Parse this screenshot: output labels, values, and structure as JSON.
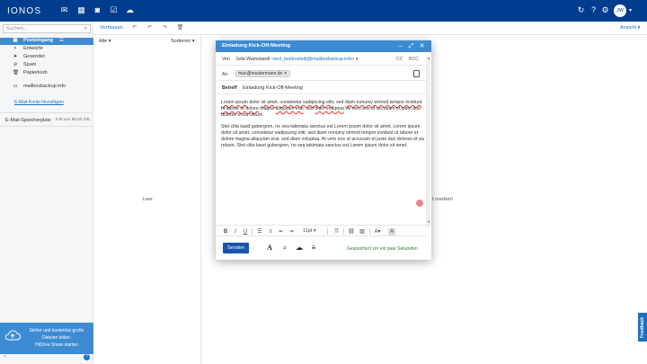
{
  "topbar": {
    "logo": "IONOS",
    "avatar_initials": "JW",
    "nav_icons": [
      "mail-icon",
      "calendar-icon",
      "contacts-icon",
      "tasks-icon",
      "cloud-icon"
    ],
    "right_icons": [
      "refresh-icon",
      "help-icon",
      "settings-icon"
    ]
  },
  "sidebar": {
    "search_placeholder": "Suchen...",
    "folders": [
      {
        "label": "Posteingang",
        "icon": "inbox-icon",
        "active": true
      },
      {
        "label": "Entwürfe",
        "icon": "drafts-icon"
      },
      {
        "label": "Gesendet",
        "icon": "sent-icon"
      },
      {
        "label": "Spam",
        "icon": "spam-icon"
      },
      {
        "label": "Papierkorb",
        "icon": "trash-icon"
      }
    ],
    "account_folder": "mailboxbackup.info",
    "add_account": "E-Mail-Konto hinzufügen",
    "storage_label": "E-Mail-Speicherplatz",
    "storage_value": "0 B von 50,00 GB",
    "hidrive": {
      "line1": "Sicher und kostenlos große",
      "line2": "Dateien teilen:",
      "line3": "HiDrive Share starten"
    }
  },
  "toolbar": {
    "compose": "Verfassen",
    "view": "Ansicht"
  },
  "list": {
    "filter": "Alle",
    "sort": "Sortieren",
    "empty": "Leer",
    "detail_hint": "t markiert"
  },
  "compose": {
    "title": "Einladung Kick-Off-Meeting",
    "from_label": "Von",
    "from_name": "Julia Warnstaedt",
    "from_addr": "<test_testtrustedt@mailboxbackup.info>",
    "cc": "CC",
    "bcc": "BCC",
    "to_label": "An",
    "to_chip": "max@mustermann.de",
    "subject_label": "Betreff",
    "subject": "Einladung Kick-Off-Meeting",
    "p1_a": "Lorem ipsum",
    "p1_b": " dolor ",
    "p1_c": "sit amet",
    "p1_d": ", ",
    "p1_e": "consetetur sadipscing elitr",
    "p1_f": ", sed ",
    "p1_g": "diam nonumy eirmod tempor invidunt ut labore et dolore",
    "p1_h": " magna ",
    "p1_i": "aliquyam erat",
    "p1_j": ", sed ",
    "p1_k": "diam voluptua",
    "p1_l": ". At vero eos et accusam et justo duo dolores et ea rebum.",
    "p2": "Stet clita kasd gubergren, no sea takimata sanctus est Lorem ipsum dolor sit amet. Lorem ipsum dolor sit amet, consetetur sadipscing elitr, sed diam nonumy eirmod tempor invidunt ut labore et dolore magna aliquyam erat, sed diam voluptua. At vero eos et accusam et justo duo dolores et ea rebum. Stet clita kasd gubergren, no sea takimata sanctus est Lorem ipsum dolor sit amet.",
    "font_size": "11pt",
    "send": "Senden",
    "saved": "Gespeichert vor ein paar Sekunden"
  },
  "feedback": "Feedback",
  "colors": {
    "brand": "#003d8f",
    "accent": "#3d8cd3"
  }
}
